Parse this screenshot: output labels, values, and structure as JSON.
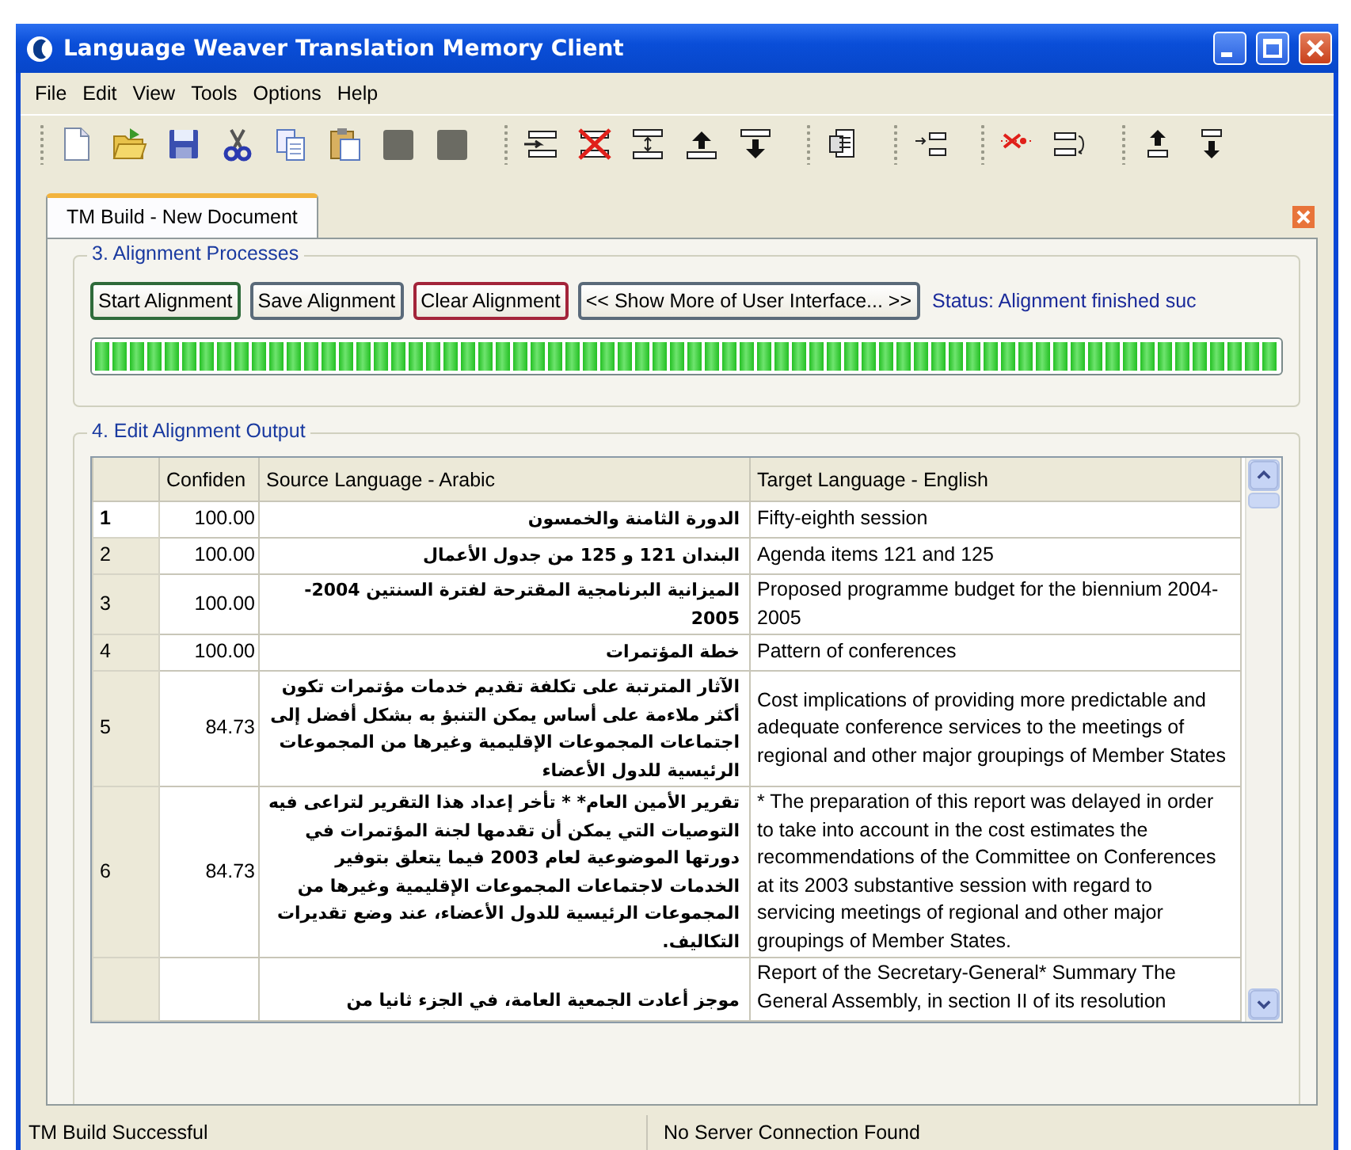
{
  "window": {
    "title": "Language Weaver Translation Memory Client"
  },
  "menu": [
    "File",
    "Edit",
    "View",
    "Tools",
    "Options",
    "Help"
  ],
  "tabs": [
    {
      "label": "TM Build - New Document",
      "selected": true
    }
  ],
  "alignment_processes": {
    "title": "3. Alignment Processes",
    "buttons": [
      {
        "label": "Start Alignment",
        "color": "#2f6b3a"
      },
      {
        "label": "Save Alignment",
        "color": "#5a6a7a"
      },
      {
        "label": "Clear Alignment",
        "color": "#a3243a"
      },
      {
        "label": "<< Show More of User Interface... >>",
        "color": "#5a6a7a"
      }
    ],
    "status": "Status: Alignment finished suc",
    "progress": {
      "level": 1
    }
  },
  "edit_alignment_output": {
    "title": "4. Edit Alignment Output",
    "columns": [
      "Confiden",
      "Source Language - Arabic",
      "Target Language - English"
    ],
    "rows": [
      {
        "number": "1",
        "current": true,
        "confidence": "100.00",
        "source": "الدورة الثامنة والخمسون",
        "target": "Fifty-eighth session"
      },
      {
        "number": "2",
        "current": false,
        "confidence": "100.00",
        "source": "البندان 121 و 125 من جدول الأعمال",
        "target": "Agenda items 121 and 125"
      },
      {
        "number": "3",
        "current": false,
        "confidence": "100.00",
        "source": "الميزانية البرنامجية المقترحة لفترة السنتين 2004-2005",
        "target": "Proposed programme budget for the biennium 2004-2005"
      },
      {
        "number": "4",
        "current": false,
        "confidence": "100.00",
        "source": "خطة المؤتمرات",
        "target": "Pattern of conferences"
      },
      {
        "number": "5",
        "current": false,
        "confidence": "84.73",
        "source": "الآثار المترتبة على تكلفة تقديم خدمات مؤتمرات تكون أكثر ملاءمة على أساس يمكن التنبؤ به بشكل أفضل إلى اجتماعات المجموعات الإقليمية وغيرها من المجموعات الرئيسية للدول الأعضاء",
        "target": "Cost implications of providing more predictable and adequate conference services to the meetings of regional and other major groupings of Member States"
      },
      {
        "number": "6",
        "current": false,
        "confidence": "84.73",
        "source": "تقرير الأمين العام* * تأخر إعداد هذا التقرير لتراعى فيه التوصيات التي يمكن أن تقدمها لجنة المؤتمرات في دورتها الموضوعية لعام 2003 فيما يتعلق بتوفير الخدمات لاجتماعات المجموعات الإقليمية وغيرها من المجموعات الرئيسية للدول الأعضاء، عند وضع تقديرات التكاليف.",
        "target": "* The preparation of this report was delayed in order to take into account in the cost estimates the recommendations of the Committee on Conferences at its 2003 substantive session with regard to servicing meetings of regional and other major groupings of Member States."
      },
      {
        "current": false,
        "source": "موجز   أعادت الجمعية العامة، في الجزء ثانيا من",
        "target": "Report of the Secretary-General* Summary   The General Assembly, in section II of its resolution"
      }
    ]
  },
  "status_bar": [
    "TM Build Successful",
    "No Server Connection Found"
  ]
}
